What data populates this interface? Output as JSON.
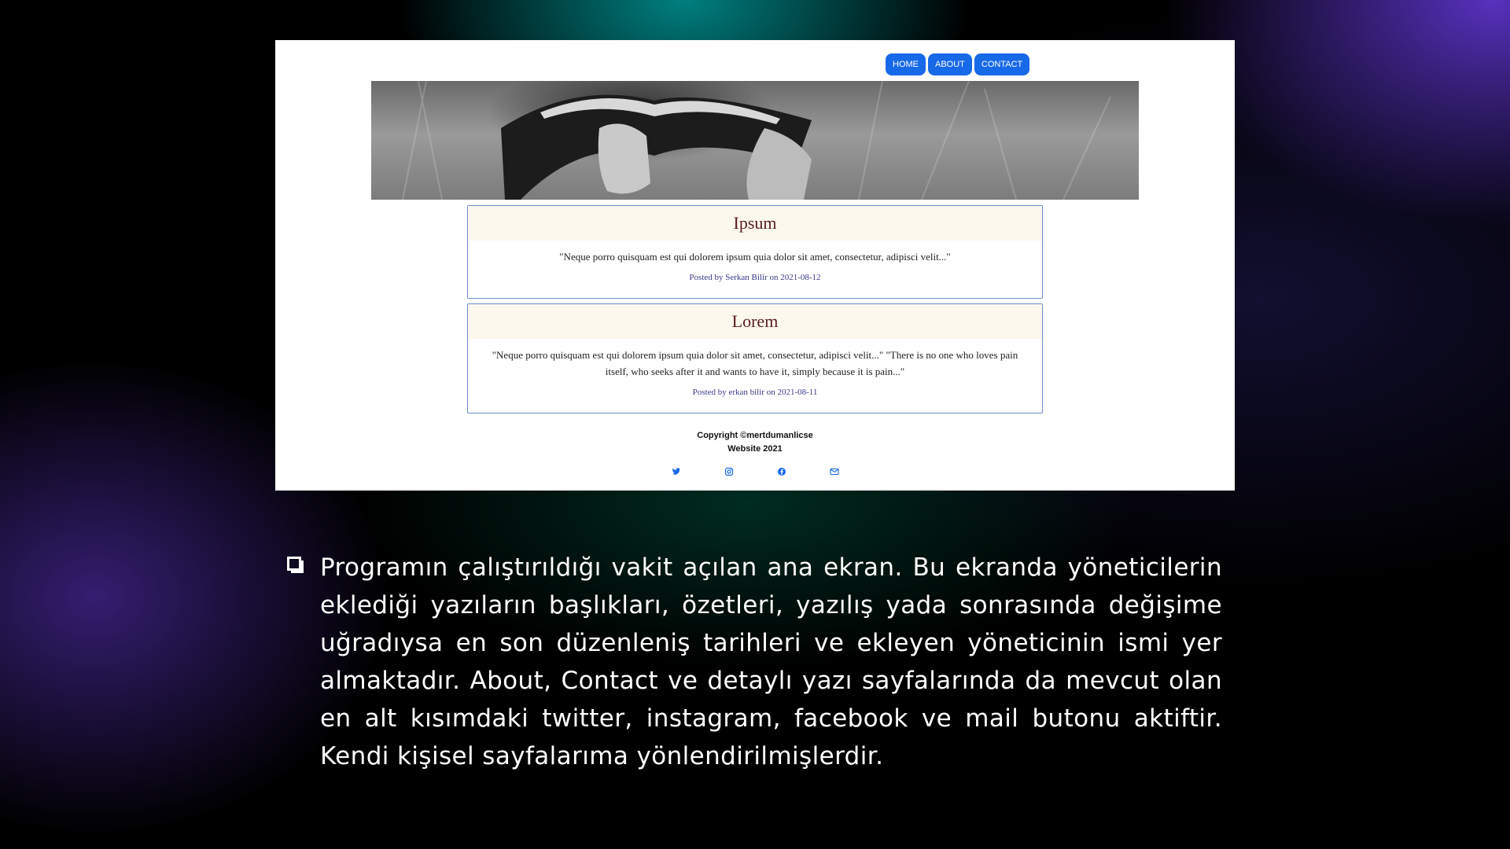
{
  "nav": {
    "home": "HOME",
    "about": "ABOUT",
    "contact": "CONTACT"
  },
  "posts": [
    {
      "title": "Ipsum",
      "excerpt": "\"Neque porro quisquam est qui dolorem ipsum quia dolor sit amet, consectetur, adipisci velit...\"",
      "meta": "Posted by Serkan Bilir on 2021-08-12"
    },
    {
      "title": "Lorem",
      "excerpt": "\"Neque porro quisquam est qui dolorem ipsum quia dolor sit amet, consectetur, adipisci velit...\" \"There is no one who loves pain itself, who seeks after it and wants to have it, simply because it is pain...\"",
      "meta": "Posted by erkan bilir on 2021-08-11"
    }
  ],
  "footer": {
    "copyright": "Copyright ©mertdumanlicse",
    "year": "Website 2021"
  },
  "social_icons": [
    "twitter-icon",
    "instagram-icon",
    "facebook-icon",
    "mail-icon"
  ],
  "description": "Programın çalıştırıldığı vakit açılan ana ekran. Bu ekranda yöneticilerin eklediği yazıların başlıkları, özetleri, yazılış yada sonrasında değişime uğradıysa en son düzenleniş tarihleri ve ekleyen yöneticinin ismi yer almaktadır. About, Contact ve detaylı yazı sayfalarında da mevcut olan en alt kısımdaki twitter, instagram, facebook ve mail butonu aktiftir. Kendi kişisel sayfalarıma yönlendirilmişlerdir.",
  "colors": {
    "nav_button": "#1769e8",
    "card_border": "#6b8ccc",
    "card_header": "#fcf8ee",
    "title": "#5a1e1e"
  }
}
